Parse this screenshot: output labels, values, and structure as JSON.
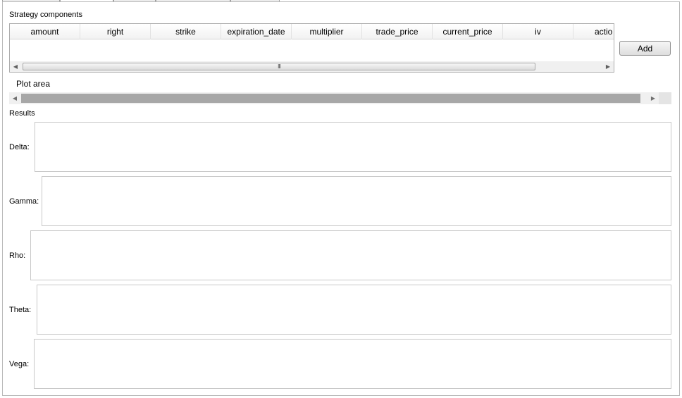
{
  "strategy": {
    "label": "Strategy components",
    "columns": [
      "amount",
      "right",
      "strike",
      "expiration_date",
      "multiplier",
      "trade_price",
      "current_price",
      "iv",
      "actio"
    ],
    "scroll_grip": "III"
  },
  "add_button": {
    "label": "Add"
  },
  "plot": {
    "label": "Plot area"
  },
  "results": {
    "label": "Results",
    "rows": [
      {
        "label": "Delta:",
        "value": ""
      },
      {
        "label": "Gamma:",
        "value": ""
      },
      {
        "label": "Rho:",
        "value": ""
      },
      {
        "label": "Theta:",
        "value": ""
      },
      {
        "label": "Vega:",
        "value": ""
      }
    ]
  },
  "icons": {
    "scroll_left": "arrow-left-icon",
    "scroll_right": "arrow-right-icon"
  }
}
